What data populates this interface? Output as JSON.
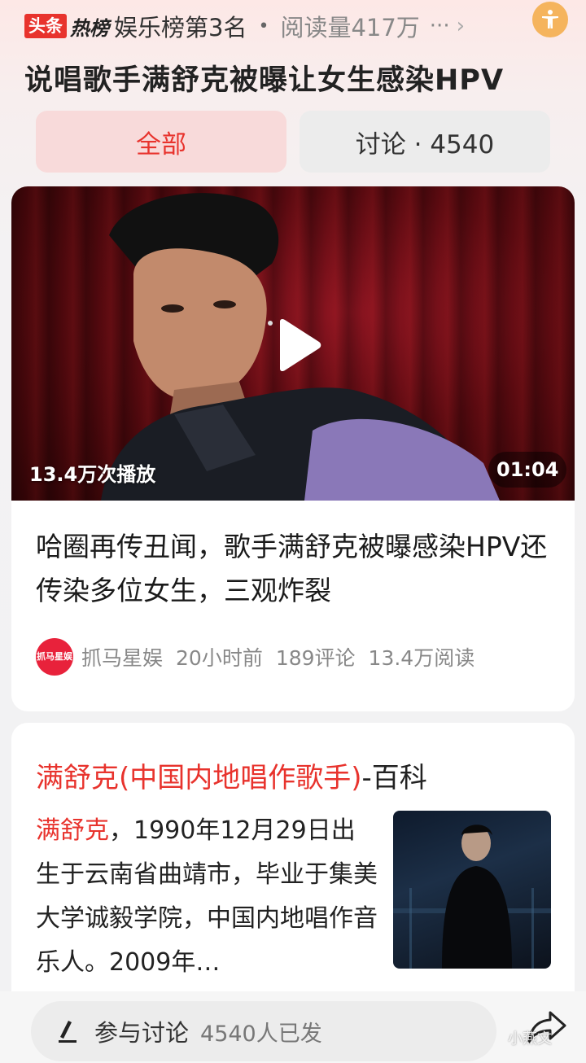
{
  "header": {
    "logo_left": "头条",
    "logo_right": "热榜",
    "rank": "娱乐榜第3名",
    "separator": "•",
    "reads": "阅读量417万",
    "more": "···",
    "chevron": "›"
  },
  "headline": "说唱歌手满舒克被曝让女生感染HPV",
  "tabs": {
    "all": "全部",
    "discussion": "讨论 · 4540"
  },
  "video": {
    "plays": "13.4万次播放",
    "duration": "01:04",
    "title": "哈圈再传丑闻，歌手满舒克被曝感染HPV还传染多位女生，三观炸裂",
    "source_avatar": "抓马星娱",
    "source": "抓马星娱",
    "time": "20小时前",
    "comments": "189评论",
    "reads": "13.4万阅读"
  },
  "wiki": {
    "title_name": "满舒克",
    "title_paren_open": "(",
    "title_desc": "中国内地唱作歌手",
    "title_paren_close": ")",
    "title_suffix": "-百科",
    "body_name": "满舒克",
    "body_text": "，1990年12月29日出生于云南省曲靖市，毕业于集美大学诚毅学院，中国内地唱作音乐人。2009年…"
  },
  "bottom": {
    "comment_label": "参与讨论",
    "comment_count": "4540人已发"
  },
  "watermark": "小燕文",
  "colors": {
    "accent": "#e8332d",
    "tab_active_bg": "#f8dada",
    "accessibility": "#f5b45d"
  }
}
